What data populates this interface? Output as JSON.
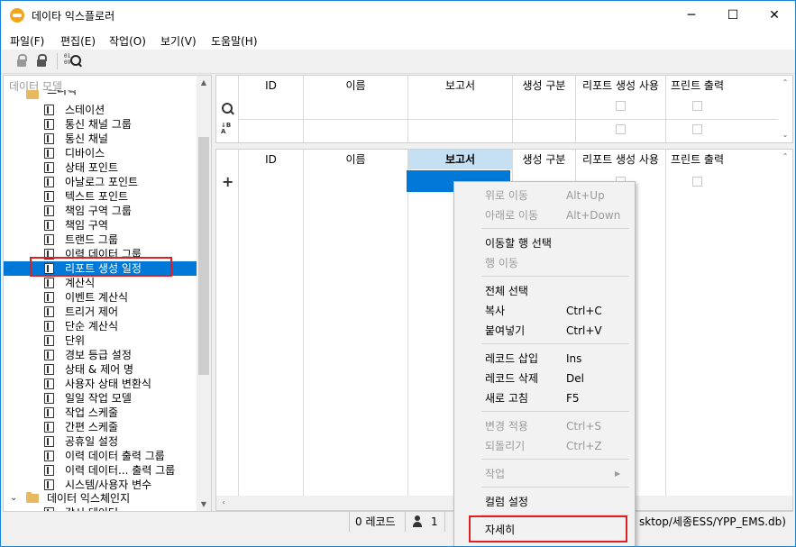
{
  "window": {
    "title": "데이타 익스플로러",
    "minimize": "─",
    "maximize": "☐",
    "close": "✕"
  },
  "menu": [
    "파일(F)",
    "편집(E)",
    "작업(O)",
    "보기(V)",
    "도움말(H)"
  ],
  "toolbar": {
    "find_nums": "01\n09"
  },
  "tree": {
    "header": "데이터 모델",
    "partial_top": "드디릭",
    "items": [
      "스테이션",
      "통신 채널 그룹",
      "통신 채널",
      "디바이스",
      "상태 포인트",
      "아날로그 포인트",
      "텍스트 포인트",
      "책임 구역 그룹",
      "책임 구역",
      "트랜드 그룹",
      "이력 데이터 그룹",
      "리포트 생성 일정",
      "계산식",
      "이벤트 계산식",
      "트리거 제어",
      "단순 계산식",
      "단위",
      "경보 등급 설정",
      "상태 & 제어 명",
      "사용자 상태 변환식",
      "일일 작업 모델",
      "작업 스케줄",
      "간편 스케줄",
      "공휴일 설정",
      "이력 데이터 출력 그룹",
      "이력 데이터... 출력 그룹",
      "시스템/사용자 변수"
    ],
    "selected_index": 11,
    "folder2": "데이터 익스체인지",
    "partial_bottom": "감시 데이터"
  },
  "grid_top": {
    "columns": [
      "ID",
      "이름",
      "보고서",
      "생성 구분",
      "리포트 생성 사용",
      "프린트 출력"
    ]
  },
  "grid_bottom": {
    "columns": [
      "ID",
      "이름",
      "보고서",
      "생성 구분",
      "리포트 생성 사용",
      "프린트 출력"
    ],
    "highlighted_column": "보고서"
  },
  "status": {
    "records": "0 레코드",
    "users": "1",
    "path": "sktop/세종ESS/YPP_EMS.db)"
  },
  "context_menu": [
    {
      "label": "위로 이동",
      "shortcut": "Alt+Up",
      "disabled": true
    },
    {
      "label": "아래로 이동",
      "shortcut": "Alt+Down",
      "disabled": true
    },
    {
      "label": "이동할 행 선택",
      "shortcut": "",
      "disabled": false
    },
    {
      "label": "행 이동",
      "shortcut": "",
      "disabled": true
    },
    {
      "label": "전체 선택",
      "shortcut": "",
      "disabled": false
    },
    {
      "label": "복사",
      "shortcut": "Ctrl+C",
      "disabled": false
    },
    {
      "label": "붙여넣기",
      "shortcut": "Ctrl+V",
      "disabled": false
    },
    {
      "label": "레코드 삽입",
      "shortcut": "Ins",
      "disabled": false
    },
    {
      "label": "레코드 삭제",
      "shortcut": "Del",
      "disabled": false
    },
    {
      "label": "새로 고침",
      "shortcut": "F5",
      "disabled": false
    },
    {
      "label": "변경 적용",
      "shortcut": "Ctrl+S",
      "disabled": true
    },
    {
      "label": "되돌리기",
      "shortcut": "Ctrl+Z",
      "disabled": true
    },
    {
      "label": "작업",
      "shortcut": "",
      "disabled": true
    },
    {
      "label": "컬럼 설정",
      "shortcut": "",
      "disabled": false
    },
    {
      "label": "자세히",
      "shortcut": "",
      "disabled": false
    }
  ],
  "colors": {
    "selection": "#0078d7",
    "highlight_header": "#c5dff3",
    "annotation_red": "#e02020"
  }
}
